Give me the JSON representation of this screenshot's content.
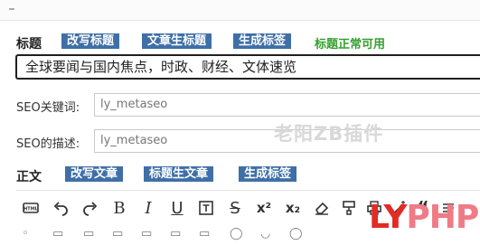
{
  "title_row": {
    "label": "标题",
    "buttons": [
      "改写标题",
      "文章生标题",
      "生成标签"
    ],
    "status": "标题正常可用",
    "value": "全球要闻与国内焦点，时政、财经、文体速览"
  },
  "seo": {
    "keywords_label": "SEO关键词:",
    "keywords_placeholder": "ly_metaseo",
    "description_label": "SEO的描述:",
    "description_placeholder": "ly_metaseo"
  },
  "body_row": {
    "label": "正文",
    "buttons": [
      "改写文章",
      "标题生文章",
      "生成标签"
    ]
  },
  "toolbar_icons": [
    "html-icon",
    "undo-icon",
    "redo-icon",
    "bold-icon",
    "italic-icon",
    "underline-icon",
    "text-border-icon",
    "strikethrough-icon",
    "superscript-icon",
    "subscript-icon",
    "eraser-icon",
    "format-painter-icon",
    "print-icon",
    "magic-icon",
    "blockquote-icon",
    "more-icon"
  ],
  "toolbar_glyphs": {
    "bold": "B",
    "italic": "I",
    "underline": "U",
    "strike": "S",
    "sup": "x²",
    "sub": "x₂"
  },
  "watermark": "老阳ZB插件",
  "logo": {
    "part1": "LY",
    "part2": "PHP"
  },
  "colors": {
    "button_bg": "#3f6fa6",
    "status_green": "#33a02c",
    "logo_red": "#e32b26",
    "logo_pink": "#f07a86"
  }
}
